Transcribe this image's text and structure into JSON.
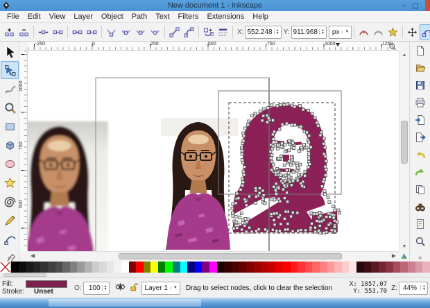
{
  "window": {
    "title": "New document 1 - Inkscape",
    "minimize_glyph": "–",
    "maximize_glyph": "▢"
  },
  "menu_bar": {
    "items": [
      "File",
      "Edit",
      "View",
      "Layer",
      "Object",
      "Path",
      "Text",
      "Filters",
      "Extensions",
      "Help"
    ]
  },
  "node_toolbar": {
    "left_buttons": [
      "insert-node",
      "delete-node",
      "|",
      "join-nodes",
      "break-nodes",
      "|",
      "join-with-segment",
      "delete-segment",
      "|",
      "corner-node",
      "smooth-node",
      "symmetric-node",
      "auto-smooth-node",
      "|",
      "line-segment",
      "curve-segment",
      "|",
      "object-to-path",
      "stroke-to-path",
      "|"
    ],
    "x_label": "X:",
    "x_value": "552.248",
    "y_label": "Y:",
    "y_value": "911.968",
    "unit_value": "px",
    "right_buttons": [
      "edit-clipping-path",
      "edit-mask",
      "next-path-effect",
      "|",
      "show-transform-handles",
      "show-bezier-handles",
      "show-path-outline"
    ],
    "active_button": "show-bezier-handles"
  },
  "toolbox": {
    "tools": [
      "selector-tool",
      "node-tool",
      "tweak-tool",
      "zoom-tool",
      "rectangle-tool",
      "box3d-tool",
      "ellipse-tool",
      "star-tool",
      "spiral-tool",
      "pencil-tool",
      "bezier-tool",
      "calligraphy-tool"
    ],
    "active_tool": "node-tool",
    "overflow_glyph": "»"
  },
  "command_bar": {
    "items": [
      "new-document",
      "open-document",
      "save-document",
      "print-document",
      "import-bitmap",
      "export-bitmap",
      "undo",
      "redo",
      "duplicate",
      "find",
      "document-properties",
      "zoom-to-fit"
    ],
    "overflow_glyph": "»"
  },
  "rulers": {
    "horizontal_labels": [
      "-250",
      "0",
      "250",
      "500",
      "750",
      "1000",
      "1250"
    ],
    "vertical_labels": [
      "1000",
      "750",
      "500"
    ]
  },
  "palette": {
    "colors": [
      "none",
      "#000000",
      "#0d0d0d",
      "#1a1a1a",
      "#262626",
      "#333333",
      "#404040",
      "#4d4d4d",
      "#666666",
      "#808080",
      "#999999",
      "#b3b3b3",
      "#cccccc",
      "#d9d9d9",
      "#e6e6e6",
      "#f2f2f2",
      "#ffffff",
      "#800000",
      "#ff0000",
      "#808000",
      "#ffff00",
      "#008000",
      "#00ff00",
      "#008080",
      "#00ffff",
      "#000080",
      "#0000ff",
      "#800080",
      "#ff00ff",
      "#1a0000",
      "#330000",
      "#4d0000",
      "#660000",
      "#800000",
      "#990000",
      "#b30000",
      "#cc0000",
      "#e60000",
      "#ff0000",
      "#ff1a1a",
      "#ff3333",
      "#ff4d4d",
      "#ff6666",
      "#ff8080",
      "#ff9999",
      "#ffb3b3",
      "#ffcccc",
      "#ffe6e6",
      "#26080d",
      "#400d14",
      "#591a22",
      "#732633",
      "#8c3342",
      "#a64d5c",
      "#bf6675",
      "#cc8091",
      "#d999a6",
      "#e6b3bf"
    ]
  },
  "status_bar": {
    "fill_label": "Fill:",
    "fill_color": "#7b2150",
    "stroke_label": "Stroke:",
    "stroke_value": "Unset",
    "opacity_label": "O:",
    "opacity_value": "100",
    "layer_value": "Layer 1",
    "message": "Drag to select nodes, click to clear the selection",
    "x_text": "X: 1057.07",
    "y_text": "Y: 553.70",
    "zoom_label": "Z:",
    "zoom_value": "44%"
  },
  "canvas": {
    "trace_fill": "#8c2157"
  }
}
